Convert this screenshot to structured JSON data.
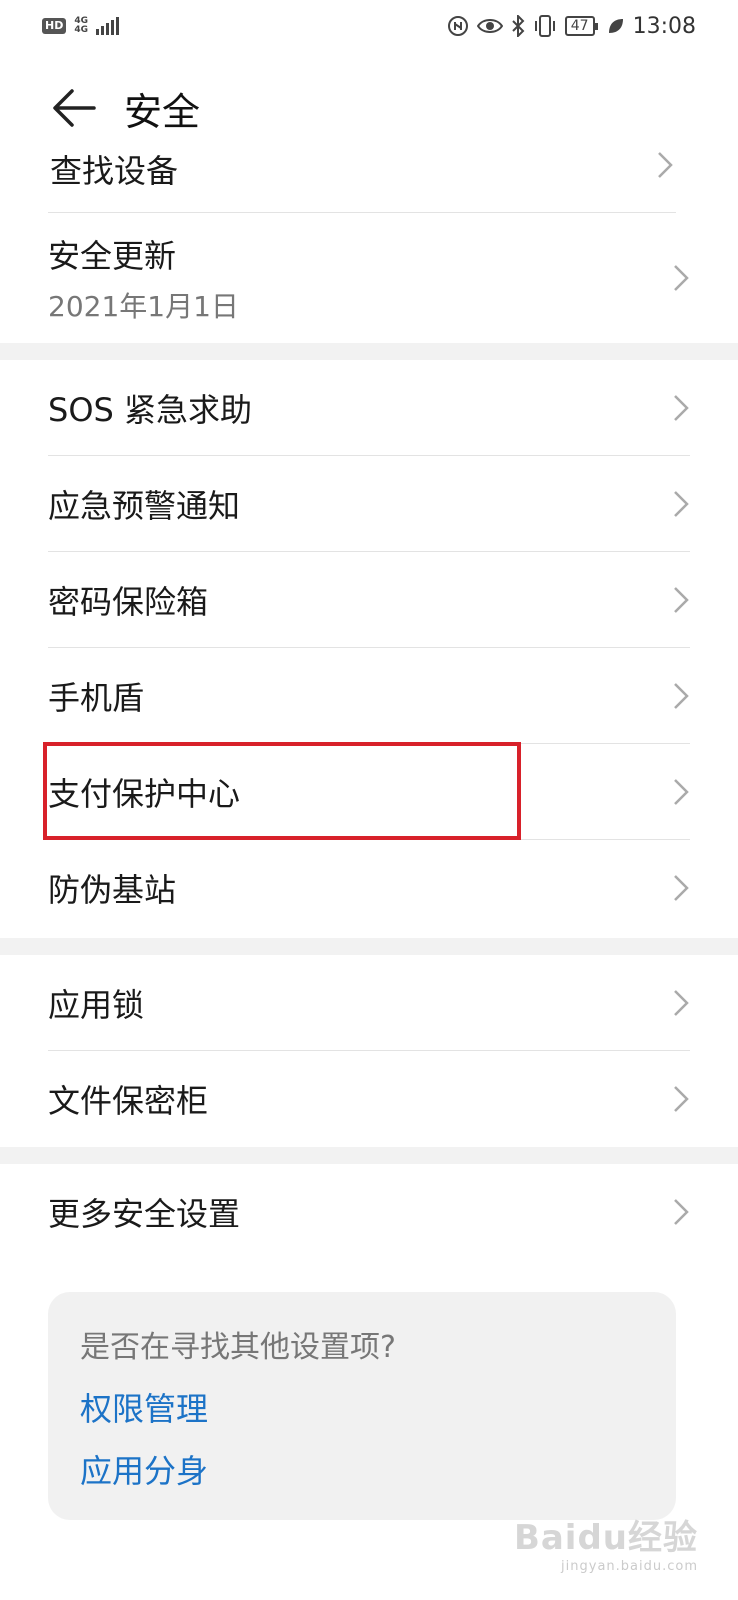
{
  "status_bar": {
    "hd": "HD",
    "net_top": "4G",
    "net_bottom": "4G",
    "battery": "47",
    "time": "13:08",
    "icons": [
      "nfc-icon",
      "eye-icon",
      "bluetooth-icon",
      "vibrate-icon",
      "leaf-icon"
    ]
  },
  "header": {
    "title": "安全"
  },
  "partial_item": {
    "label": "查找设备"
  },
  "group1": {
    "security_update": {
      "label": "安全更新",
      "value": "2021年1月1日"
    }
  },
  "group2": {
    "items": [
      {
        "label": "SOS 紧急求助"
      },
      {
        "label": "应急预警通知"
      },
      {
        "label": "密码保险箱"
      },
      {
        "label": "手机盾"
      },
      {
        "label": "支付保护中心"
      },
      {
        "label": "防伪基站"
      }
    ]
  },
  "group3": {
    "items": [
      {
        "label": "应用锁"
      },
      {
        "label": "文件保密柜"
      }
    ]
  },
  "group4": {
    "items": [
      {
        "label": "更多安全设置"
      }
    ]
  },
  "suggestions": {
    "question": "是否在寻找其他设置项?",
    "links": [
      "权限管理",
      "应用分身"
    ]
  },
  "watermark": {
    "brand": "Baidu经验",
    "url": "jingyan.baidu.com"
  },
  "colors": {
    "link": "#1c73c7",
    "highlight": "#d8212a",
    "divider": "#e3e3e3",
    "group_gap": "#f2f2f2"
  }
}
